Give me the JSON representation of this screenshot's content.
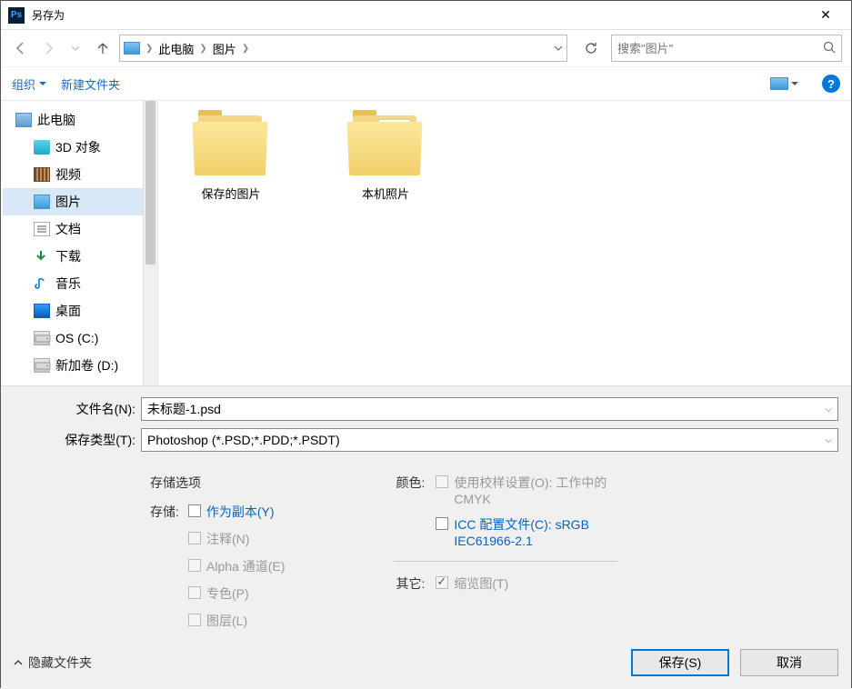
{
  "titlebar": {
    "title": "另存为"
  },
  "nav": {
    "breadcrumb": {
      "root": "此电脑",
      "folder": "图片"
    },
    "search_placeholder": "搜索\"图片\""
  },
  "toolbar": {
    "organize": "组织",
    "newfolder": "新建文件夹"
  },
  "sidebar": {
    "items": [
      {
        "label": "此电脑",
        "icon": "pc"
      },
      {
        "label": "3D 对象",
        "icon": "3d"
      },
      {
        "label": "视频",
        "icon": "video"
      },
      {
        "label": "图片",
        "icon": "pic",
        "selected": true
      },
      {
        "label": "文档",
        "icon": "doc"
      },
      {
        "label": "下载",
        "icon": "dl"
      },
      {
        "label": "音乐",
        "icon": "music"
      },
      {
        "label": "桌面",
        "icon": "desk"
      },
      {
        "label": "OS (C:)",
        "icon": "drive"
      },
      {
        "label": "新加卷 (D:)",
        "icon": "drive"
      }
    ]
  },
  "content": {
    "folders": [
      {
        "label": "保存的图片",
        "has_paper": false
      },
      {
        "label": "本机照片",
        "has_paper": true
      }
    ]
  },
  "form": {
    "filename_label": "文件名(N):",
    "filename_value": "未标题-1.psd",
    "filetype_label": "保存类型(T):",
    "filetype_value": "Photoshop (*.PSD;*.PDD;*.PSDT)"
  },
  "options": {
    "storage_title": "存储选项",
    "storage_label": "存储:",
    "as_copy": "作为副本(Y)",
    "annotations": "注释(N)",
    "alpha": "Alpha 通道(E)",
    "spot": "专色(P)",
    "layers": "图层(L)",
    "color_label": "颜色:",
    "proof": "使用校样设置(O):  工作中的 CMYK",
    "icc": "ICC 配置文件(C): sRGB IEC61966-2.1",
    "other_label": "其它:",
    "thumbnail": "缩览图(T)"
  },
  "footer": {
    "hide": "隐藏文件夹",
    "save": "保存(S)",
    "cancel": "取消"
  }
}
